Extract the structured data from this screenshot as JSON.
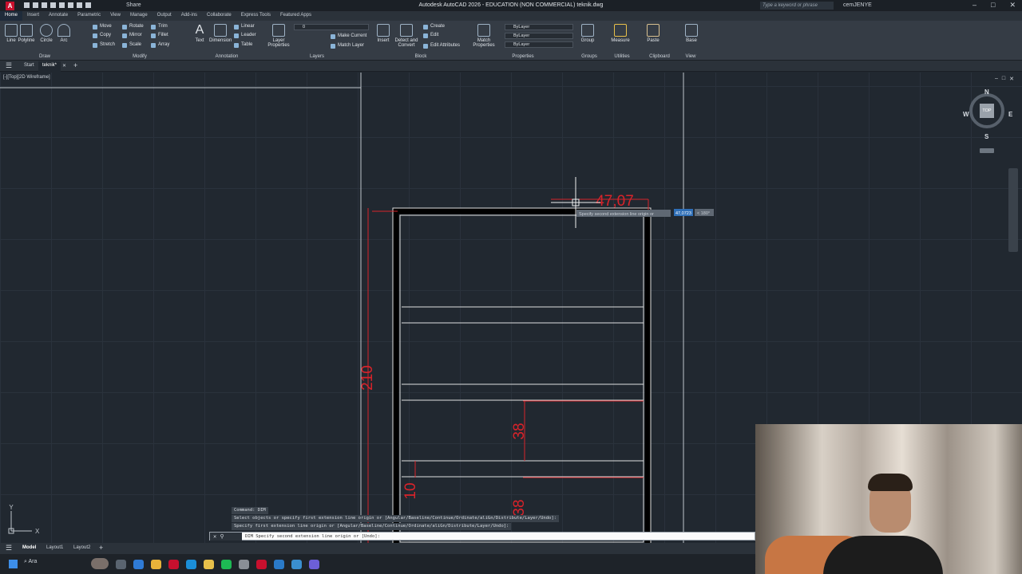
{
  "app": {
    "title": "Autodesk AutoCAD 2026 - EDUCATION (NON COMMERCIAL)   teknik.dwg",
    "logo": "A",
    "share_label": "Share",
    "search_placeholder": "Type a keyword or phrase",
    "user": "cemJENYE"
  },
  "ribbon_tabs": [
    "Home",
    "Insert",
    "Annotate",
    "Parametric",
    "View",
    "Manage",
    "Output",
    "Add-ins",
    "Collaborate",
    "Express Tools",
    "Featured Apps"
  ],
  "ribbon": {
    "draw": {
      "title": "Draw",
      "tools": [
        "Line",
        "Polyline",
        "Circle",
        "Arc"
      ]
    },
    "modify": {
      "title": "Modify",
      "tools": [
        "Move",
        "Rotate",
        "Trim",
        "Copy",
        "Mirror",
        "Fillet",
        "Stretch",
        "Scale",
        "Array"
      ]
    },
    "annotation": {
      "title": "Annotation",
      "tools": [
        "Text",
        "Dimension",
        "Linear",
        "Leader",
        "Table"
      ]
    },
    "layers": {
      "title": "Layers",
      "layer_properties": "Layer Properties",
      "current_layer": "0",
      "make_current": "Make Current",
      "match_layer": "Match Layer"
    },
    "block": {
      "title": "Block",
      "insert": "Insert",
      "detect_convert": "Detect and Convert",
      "create": "Create",
      "edit": "Edit",
      "edit_attributes": "Edit Attributes"
    },
    "properties": {
      "title": "Properties",
      "match_properties": "Match Properties",
      "color": "ByLayer",
      "linetype": "ByLayer",
      "lineweight": "ByLayer"
    },
    "groups": {
      "title": "Groups",
      "group": "Group"
    },
    "utilities": {
      "title": "Utilities",
      "measure": "Measure"
    },
    "clipboard": {
      "title": "Clipboard",
      "paste": "Paste"
    },
    "view": {
      "title": "View",
      "base": "Base"
    }
  },
  "file_tabs": {
    "start": "Start",
    "active": "teknik*"
  },
  "viewport": {
    "label": "[-][Top][2D Wireframe]",
    "viewcube": {
      "north": "N",
      "south": "S",
      "east": "E",
      "west": "W",
      "face": "TOP"
    },
    "axis_y": "Y",
    "axis_x": "X"
  },
  "dimensions": {
    "width": "47,07",
    "height": "210",
    "shelf_gap_1": "38",
    "shelf_gap_2": "10",
    "shelf_gap_3": "38"
  },
  "tooltip": {
    "prompt": "Specify second extension line origin or",
    "value": "47,0723",
    "angle": "< 180°"
  },
  "command": {
    "history": [
      "Command: DIM",
      "Select objects or specify first extension line origin or [Angular/Baseline/Continue/Ordinate/aliGn/Distribute/Layer/Undo]:",
      "Specify first extension line origin or [Angular/Baseline/Continue/Ordinate/aliGn/Distribute/Layer/Undo]:"
    ],
    "current": "DIM Specify second extension line origin or [Undo]:"
  },
  "layout_tabs": [
    "Model",
    "Layout1",
    "Layout2"
  ],
  "taskbar": {
    "search": "Ara"
  },
  "colors": {
    "dimension": "#d8232a",
    "background": "#212830",
    "ribbon": "#353c45"
  }
}
